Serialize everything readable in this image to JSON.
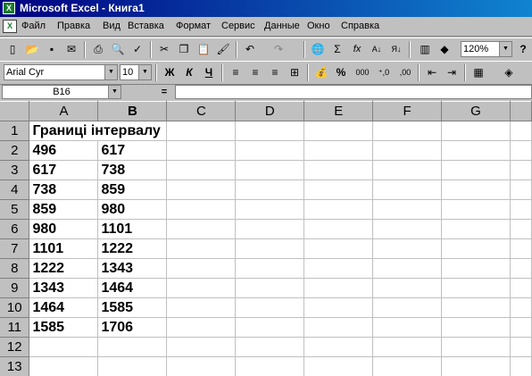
{
  "window": {
    "title": "Microsoft Excel - Книга1"
  },
  "menu": [
    "Файл",
    "Правка",
    "Вид",
    "Вставка",
    "Формат",
    "Сервис",
    "Данные",
    "Окно",
    "Справка"
  ],
  "toolbar": {
    "zoom": "120%",
    "font_name": "Arial Cyr",
    "font_size": "10",
    "bold_label": "Ж",
    "italic_label": "К",
    "underline_label": "Ч",
    "percent_label": "%",
    "thousands_label": "000",
    "inc_decimal_label": "⁺,0",
    "dec_decimal_label": ",00",
    "sigma_label": "Σ",
    "fx_label": "fx"
  },
  "formula_bar": {
    "name_box": "B16",
    "equals": "=",
    "value": ""
  },
  "sheet": {
    "columns": [
      "A",
      "B",
      "C",
      "D",
      "E",
      "F",
      "G"
    ],
    "rows": [
      {
        "num": "1",
        "a": "Границі інтервалу",
        "b": ""
      },
      {
        "num": "2",
        "a": "496",
        "b": "617"
      },
      {
        "num": "3",
        "a": "617",
        "b": "738"
      },
      {
        "num": "4",
        "a": "738",
        "b": "859"
      },
      {
        "num": "5",
        "a": "859",
        "b": "980"
      },
      {
        "num": "6",
        "a": "980",
        "b": "1101"
      },
      {
        "num": "7",
        "a": "1101",
        "b": "1222"
      },
      {
        "num": "8",
        "a": "1222",
        "b": "1343"
      },
      {
        "num": "9",
        "a": "1343",
        "b": "1464"
      },
      {
        "num": "10",
        "a": "1464",
        "b": "1585"
      },
      {
        "num": "11",
        "a": "1585",
        "b": "1706"
      },
      {
        "num": "12",
        "a": "",
        "b": ""
      },
      {
        "num": "13",
        "a": "",
        "b": ""
      }
    ]
  }
}
